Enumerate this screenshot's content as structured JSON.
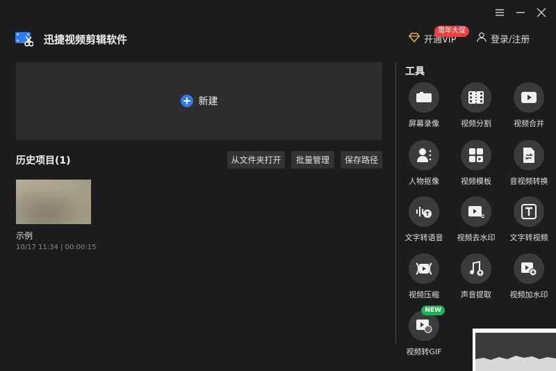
{
  "app": {
    "name": "迅捷视频剪辑软件"
  },
  "window_controls": {
    "menu": "menu-icon",
    "minimize": "minimize-icon",
    "close": "close-icon"
  },
  "header": {
    "vip_label": "开通VIP",
    "vip_badge": "周年大促",
    "login_label": "登录/注册"
  },
  "new_project": {
    "label": "新建"
  },
  "history": {
    "title": "历史项目(1)",
    "buttons": [
      "从文件夹打开",
      "批量管理",
      "保存路径"
    ],
    "projects": [
      {
        "name": "示例",
        "meta": "10/17 11:34 | 00:00:15"
      }
    ]
  },
  "tools": {
    "title": "工具",
    "items": [
      {
        "label": "屏幕录像",
        "icon": "camera-icon"
      },
      {
        "label": "视频分割",
        "icon": "film-split-icon"
      },
      {
        "label": "视频合并",
        "icon": "video-merge-icon"
      },
      {
        "label": "人物抠像",
        "icon": "person-cutout-icon"
      },
      {
        "label": "视频模板",
        "icon": "template-icon"
      },
      {
        "label": "音视频转换",
        "icon": "convert-icon"
      },
      {
        "label": "文字转语音",
        "icon": "text-to-speech-icon"
      },
      {
        "label": "视频去水印",
        "icon": "remove-watermark-icon"
      },
      {
        "label": "文字转视频",
        "icon": "text-to-video-icon"
      },
      {
        "label": "视频压缩",
        "icon": "compress-icon"
      },
      {
        "label": "声音提取",
        "icon": "audio-extract-icon"
      },
      {
        "label": "视频加水印",
        "icon": "add-watermark-icon"
      },
      {
        "label": "视频转GIF",
        "icon": "gif-icon",
        "tag": "NEW"
      }
    ]
  },
  "colors": {
    "background": "#1c1c1c",
    "panel": "#2d2d2d",
    "accent": "#2f7bf2",
    "vip_badge": "#e8403e",
    "new_tag": "#20b255"
  }
}
